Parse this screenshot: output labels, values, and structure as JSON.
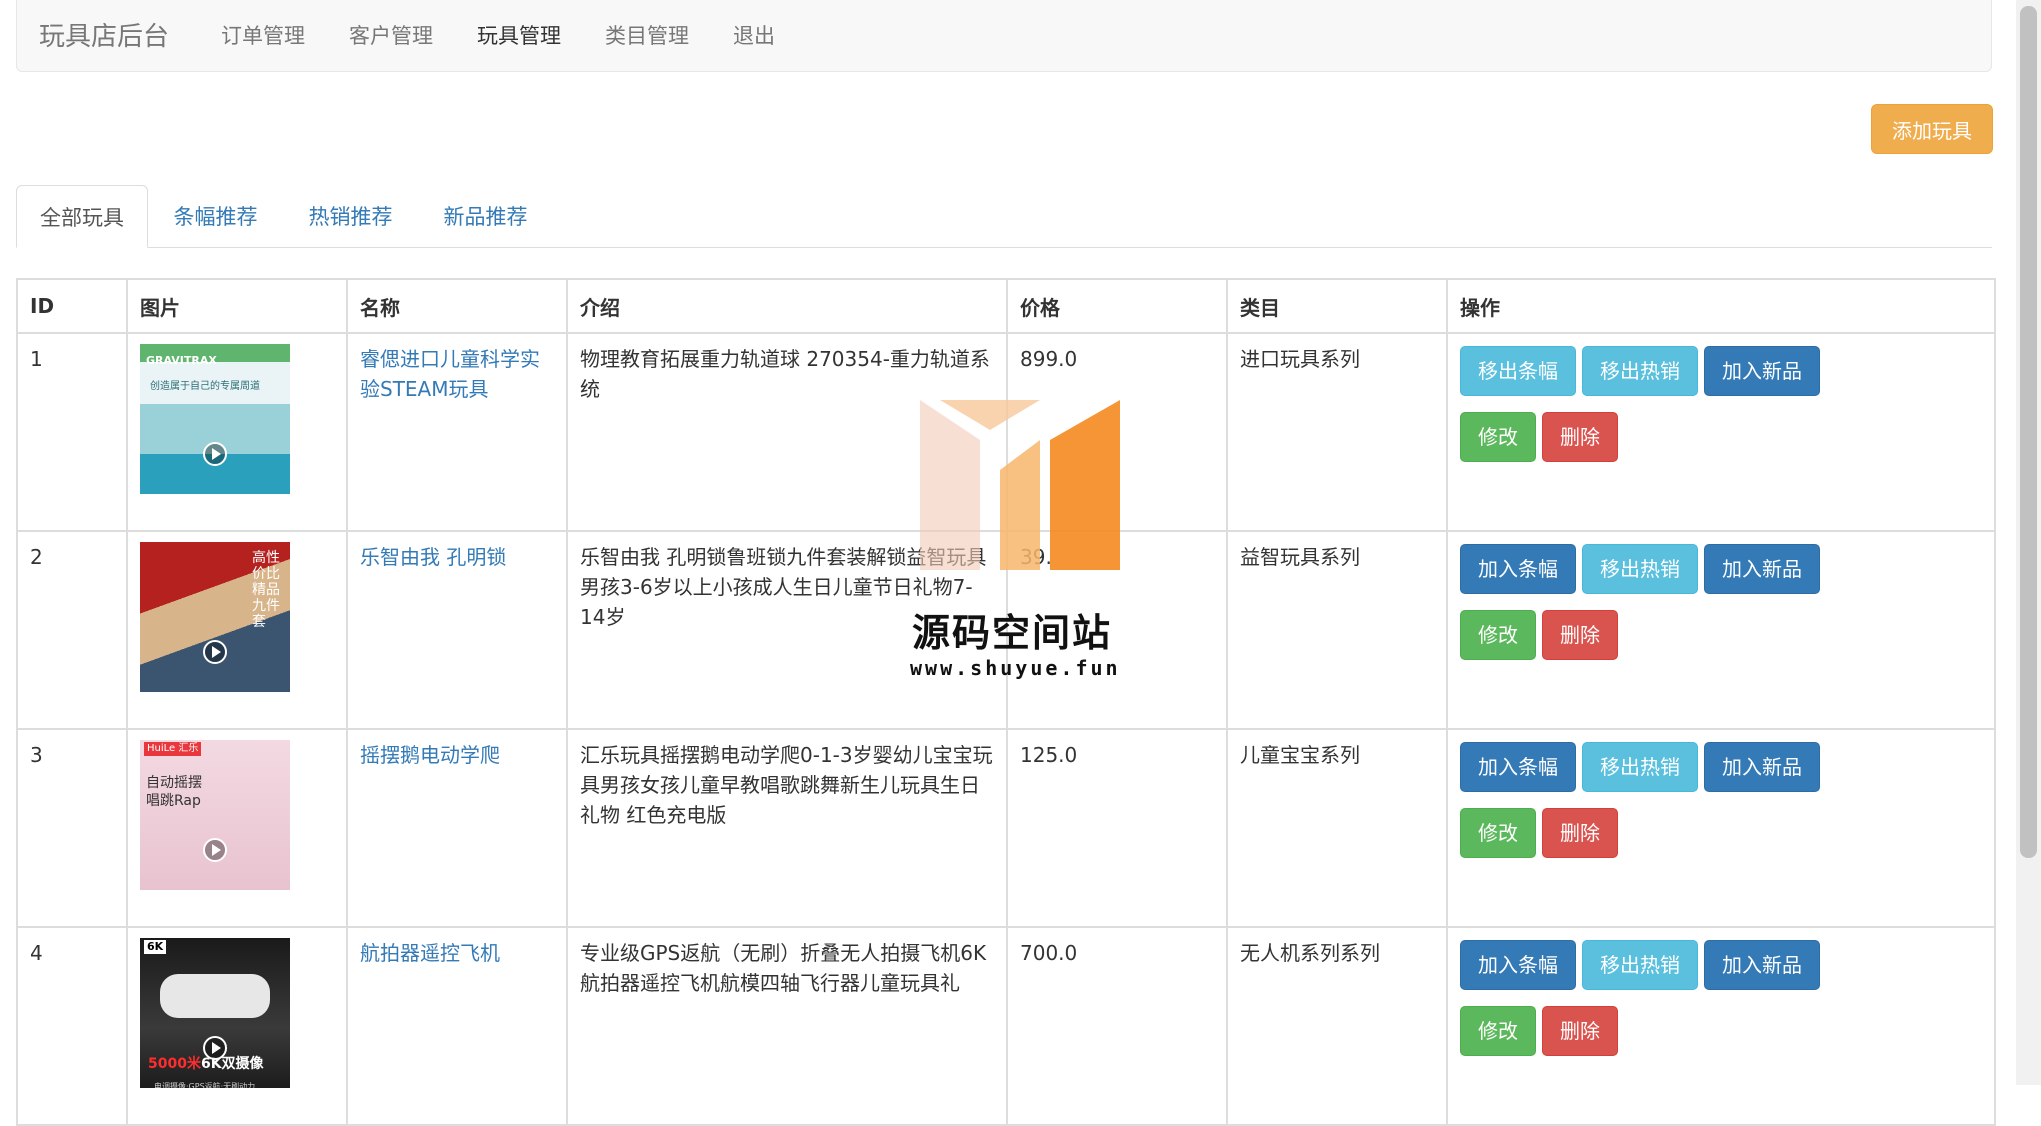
{
  "navbar": {
    "brand": "玩具店后台",
    "links": [
      "订单管理",
      "客户管理",
      "玩具管理",
      "类目管理",
      "退出"
    ]
  },
  "add_button": "添加玩具",
  "tabs": [
    "全部玩具",
    "条幅推荐",
    "热销推荐",
    "新品推荐"
  ],
  "table": {
    "headers": [
      "ID",
      "图片",
      "名称",
      "介绍",
      "价格",
      "类目",
      "操作"
    ],
    "rows": [
      {
        "id": "1",
        "name": "睿偲进口儿童科学实验STEAM玩具",
        "desc": "物理教育拓展重力轨道球 270354-重力轨道系统",
        "price": "899.0",
        "category": "进口玩具系列",
        "image_text": "GRAVITRAX",
        "image_subtext": "创造属于自己的专属周道",
        "actions": [
          "移出条幅",
          "移出热销",
          "加入新品"
        ]
      },
      {
        "id": "2",
        "name": "乐智由我 孔明锁",
        "desc": "乐智由我 孔明锁鲁班锁九件套装解锁益智玩具男孩3-6岁以上小孩成人生日儿童节日礼物7-14岁",
        "price": "39.",
        "category": "益智玩具系列",
        "image_text": "高性价比精品九件套",
        "actions": [
          "加入条幅",
          "移出热销",
          "加入新品"
        ]
      },
      {
        "id": "3",
        "name": "摇摆鹅电动学爬",
        "desc": "汇乐玩具摇摆鹅电动学爬0-1-3岁婴幼儿宝宝玩具男孩女孩儿童早教唱歌跳舞新生儿玩具生日礼物 红色充电版",
        "price": "125.0",
        "category": "儿童宝宝系列",
        "image_tag": "HuiLe 汇乐",
        "image_text": "自动摇摆唱跳Rap",
        "actions": [
          "加入条幅",
          "移出热销",
          "加入新品"
        ]
      },
      {
        "id": "4",
        "name": "航拍器遥控飞机",
        "desc": "专业级GPS返航（无刷）折叠无人拍摄飞机6K航拍器遥控飞机航模四轴飞行器儿童玩具礼",
        "price": "700.0",
        "category": "无人机系列系列",
        "image_tag": "6K",
        "image_text_red": "5000米",
        "image_text_white": "6K双摄像",
        "image_subtext": "电调摄像·GPS返航·无刷动力",
        "actions": [
          "加入条幅",
          "移出热销",
          "加入新品"
        ]
      }
    ],
    "edit_label": "修改",
    "delete_label": "删除"
  },
  "watermark": {
    "title": "源码空间站",
    "url": "www.shuyue.fun"
  },
  "colors": {
    "link": "#337ab7",
    "warning": "#f0ad4e",
    "info": "#5bc0de",
    "primary": "#337ab7",
    "success": "#5cb85c",
    "danger": "#d9534f"
  }
}
